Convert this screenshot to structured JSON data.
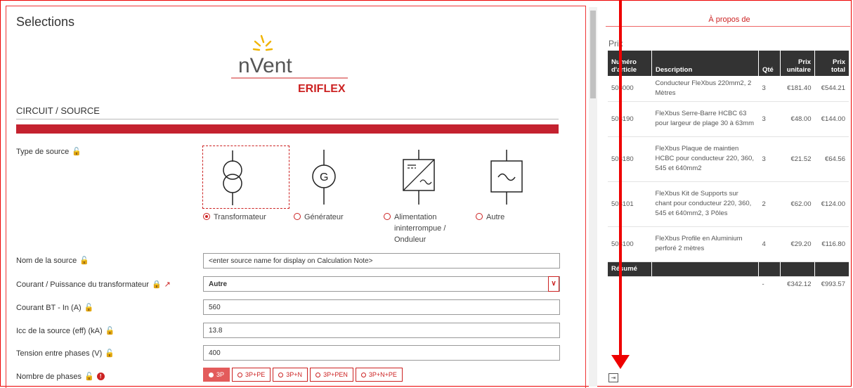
{
  "panel": {
    "title": "Selections"
  },
  "logo": {
    "brand": "nVent",
    "sub": "ERIFLEX"
  },
  "section": {
    "title": "CIRCUIT / SOURCE"
  },
  "source_type": {
    "label": "Type de source",
    "options": [
      "Transformateur",
      "Générateur",
      "Alimentation ininterrompue / Onduleur",
      "Autre"
    ],
    "selected": "Transformateur"
  },
  "fields": {
    "source_name": {
      "label": "Nom de la source",
      "placeholder": "<enter source name for display on Calculation Note>"
    },
    "current_power": {
      "label": "Courant / Puissance du transformateur",
      "value": "Autre"
    },
    "current_bt": {
      "label": "Courant BT - In (A)",
      "value": "560"
    },
    "icc": {
      "label": "Icc de la source (eff) (kA)",
      "value": "13.8"
    },
    "voltage": {
      "label": "Tension entre phases (V)",
      "value": "400"
    },
    "phases": {
      "label": "Nombre de phases",
      "options": [
        "3P",
        "3P+PE",
        "3P+N",
        "3P+PEN",
        "3P+N+PE"
      ],
      "selected": "3P"
    }
  },
  "right": {
    "about": "À propos de",
    "prix": "Prix",
    "headers": [
      "Numéro d'article",
      "Description",
      "Qté",
      "Prix unitaire",
      "Prix total"
    ],
    "rows": [
      {
        "num": "508000",
        "desc": "Conducteur FleXbus 220mm2, 2 Mètres",
        "qty": "3",
        "unit": "€181.40",
        "total": "€544.21"
      },
      {
        "num": "508190",
        "desc": "FleXbus Serre-Barre HCBC 63 pour largeur de plage 30 à 63mm",
        "qty": "3",
        "unit": "€48.00",
        "total": "€144.00"
      },
      {
        "num": "508180",
        "desc": "FleXbus Plaque de maintien HCBC pour conducteur 220, 360, 545 et 640mm2",
        "qty": "3",
        "unit": "€21.52",
        "total": "€64.56"
      },
      {
        "num": "508101",
        "desc": "FleXbus Kit de Supports sur chant pour conducteur 220, 360, 545 et 640mm2, 3 Pôles",
        "qty": "2",
        "unit": "€62.00",
        "total": "€124.00"
      },
      {
        "num": "508100",
        "desc": "FleXbus Profile en Aluminium perforé 2 mètres",
        "qty": "4",
        "unit": "€29.20",
        "total": "€116.80"
      }
    ],
    "summary_label": "Résumé",
    "summary": {
      "qty": "-",
      "unit": "€342.12",
      "total": "€993.57"
    }
  }
}
